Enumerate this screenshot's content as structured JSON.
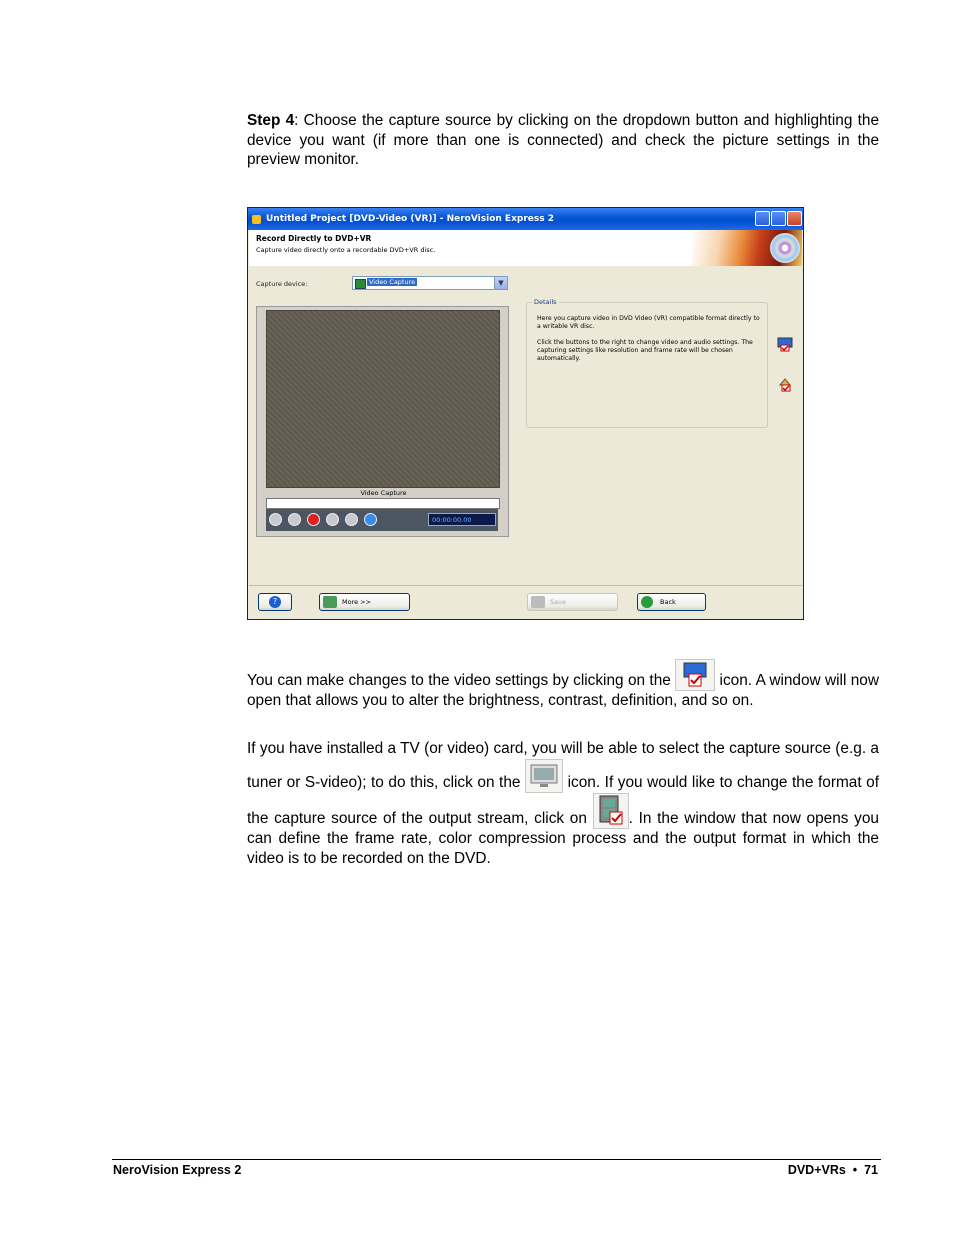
{
  "step": {
    "label": "Step 4",
    "text": ": Choose the capture source by clicking on the dropdown button and highlighting the device you want (if more than one is connected) and check the picture settings in the preview monitor."
  },
  "screenshot": {
    "title": "Untitled Project [DVD-Video (VR)] - NeroVision Express 2",
    "header_title": "Record Directly to DVD+VR",
    "header_subtitle": "Capture video directly onto a recordable DVD+VR disc.",
    "capture_device_label": "Capture device:",
    "capture_device_value": "Video Capture",
    "video_label": "Video Capture",
    "timecode": "00:00:00.00",
    "details_legend": "Details",
    "details_p1": "Here you capture video in DVD Video (VR) compatible format directly to a writable VR disc.",
    "details_p2": "Click the buttons to the right to change video and audio settings. The capturing settings like resolution and frame rate will be chosen automatically.",
    "more_button": "More >>",
    "save_button": "Save",
    "back_button": "Back"
  },
  "paragraphs": {
    "p1_a": "You can make changes to the video settings by clicking on the",
    "p1_b": "icon. A window will now open that allows you to alter the brightness, contrast, definition, and so on.",
    "p2_a": "If you have installed a TV (or video) card, you will be able to select the capture source (e.g. a tuner or S-video); to do this, click on the",
    "p2_b": "icon. If you would like to change the format of the capture source of the output stream, click on",
    "p2_c": ". In the window that now opens you can define the frame rate, color compression process and the output format in which the video is to be recorded on the DVD."
  },
  "footer": {
    "left": "NeroVision Express 2",
    "right": "DVD+VRs  •  71"
  },
  "icons": [
    "video-settings-icon",
    "capture-source-icon",
    "capture-format-icon"
  ]
}
